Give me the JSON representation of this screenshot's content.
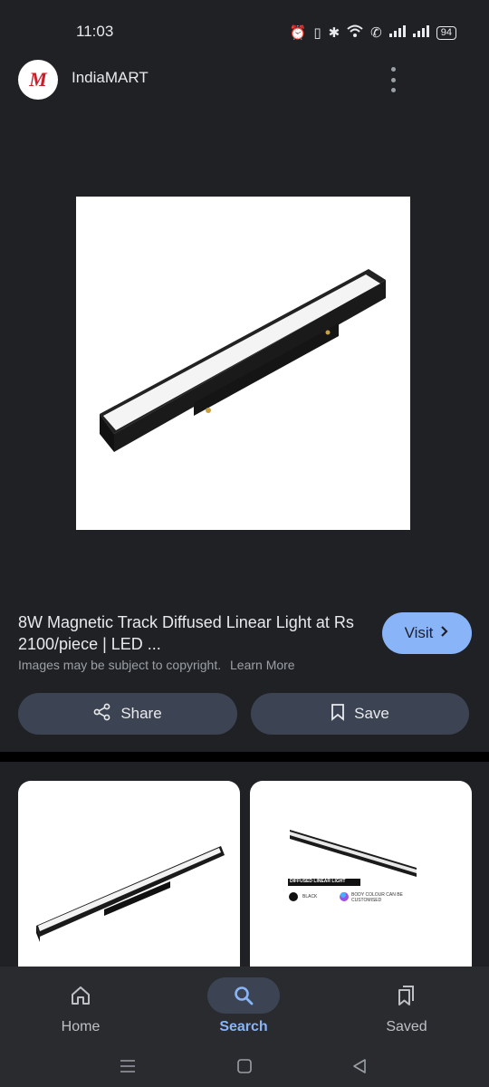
{
  "status_bar": {
    "time": "11:03",
    "battery": "94",
    "icons": [
      "alarm-icon",
      "vibrate-icon",
      "bluetooth-icon",
      "wifi-icon",
      "wifi-call-icon",
      "signal-icon",
      "signal-icon",
      "battery-icon"
    ]
  },
  "header": {
    "site_name": "IndiaMART",
    "logo_text": "M"
  },
  "result": {
    "title": "8W Magnetic Track Diffused Linear Light at Rs 2100/piece | LED ...",
    "copyright_text": "Images may be subject to copyright.",
    "learn_more_label": "Learn More",
    "visit_label": "Visit"
  },
  "actions": {
    "share_label": "Share",
    "save_label": "Save"
  },
  "related": {
    "thumb2_caption": "DIFFUSED LINEAR LIGHT",
    "thumb2_black_label": "BLACK",
    "thumb2_body_label": "BODY COLOUR CAN BE CUSTOMISED"
  },
  "bottom_nav": {
    "items": [
      {
        "label": "Home",
        "icon": "home-icon"
      },
      {
        "label": "Search",
        "icon": "search-icon",
        "active": true
      },
      {
        "label": "Saved",
        "icon": "saved-icon"
      }
    ]
  },
  "colors": {
    "background": "#202124",
    "accent": "#8ab4f8",
    "button_bg": "#3c4453",
    "nav_bg": "#2a2b2e"
  }
}
